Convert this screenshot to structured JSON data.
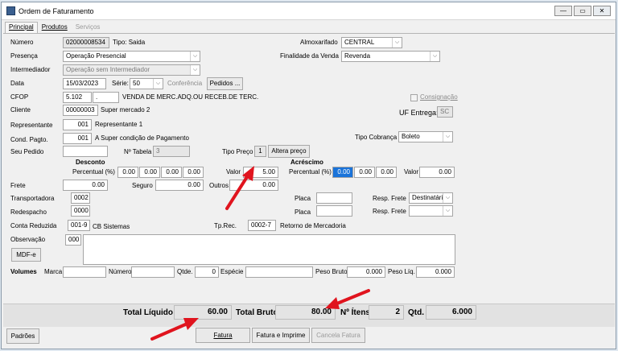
{
  "window": {
    "title": "Ordem de Faturamento",
    "min": "—",
    "max": "▭",
    "close": "✕"
  },
  "tabs": [
    {
      "label": "Principal"
    },
    {
      "label": "Produtos"
    },
    {
      "label": "Serviços"
    }
  ],
  "header": {
    "numero_label": "Número",
    "numero": "02000008534",
    "tipo": "Tipo: Saida",
    "almox_label": "Almoxarifado",
    "almox": "CENTRAL",
    "presenca_label": "Presença",
    "presenca": "Operação Presencial",
    "finalidade_label": "Finalidade da Venda",
    "finalidade": "Revenda",
    "intermediador_label": "Intermediador",
    "intermediador": "Operação sem Intermediador",
    "data_label": "Data",
    "data": "15/03/2023",
    "serie_label": "Série:",
    "serie": "50",
    "conferencia": "Conferência",
    "pedidos": "Pedidos ...",
    "cfop_label": "CFOP",
    "cfop": "5.102",
    "cfop_extra": ".",
    "cfop_desc": "VENDA DE MERC.ADQ.OU RECEB.DE TERC.",
    "consignacao": "Consignação",
    "cliente_label": "Cliente",
    "cliente_cod": "00000003",
    "cliente_nome": "Super mercado 2",
    "uf_label": "UF Entrega:",
    "uf": "SC",
    "rep_label": "Representante",
    "rep_cod": "001",
    "rep_nome": "Representante 1",
    "cond_label": "Cond. Pagto.",
    "cond_cod": "001",
    "cond_nome": "A Super condição de Pagamento",
    "tipocob_label": "Tipo Cobrança",
    "tipocob": "Boleto",
    "pedido_label": "Seu Pedido",
    "pedido": "",
    "ntabela_label": "Nº Tabela",
    "ntabela": "3",
    "tipopreco_label": "Tipo Preço",
    "tipopreco": "1",
    "altera_preco": "Altera preço"
  },
  "desconto": {
    "title": "Desconto",
    "percentual_label": "Percentual (%)",
    "percent": [
      "0.00",
      "0.00",
      "0.00",
      "0.00"
    ],
    "valor_label": "Valor",
    "valor": "5.00"
  },
  "acrescimo": {
    "title": "Acréscimo",
    "percentual_label": "Percentual (%)",
    "percent": [
      "0.00",
      "0.00",
      "0.00"
    ],
    "valor_label": "Valor",
    "valor": "0.00"
  },
  "frete": {
    "label": "Frete",
    "valor": "0.00",
    "seguro_label": "Seguro",
    "seguro": "0.00",
    "outros_label": "Outros",
    "outros": "0.00"
  },
  "transp": {
    "label": "Transportadora",
    "cod": "0002",
    "placa_label": "Placa",
    "placa": "",
    "resp_label": "Resp. Frete",
    "resp": "Destinatário"
  },
  "redesp": {
    "label": "Redespacho",
    "cod": "0000",
    "placa_label": "Placa",
    "placa": "",
    "resp_label": "Resp. Frete",
    "resp": ""
  },
  "conta": {
    "label": "Conta Reduzida",
    "cod": "001-9",
    "nome": "CB Sistemas",
    "tprec_label": "Tp.Rec.",
    "tprec": "0002-7",
    "tprec_desc": "Retorno de Mercadoria"
  },
  "obs": {
    "label": "Observação",
    "cod": "000",
    "text": ""
  },
  "mdfe": "MDF-e",
  "volumes": {
    "label": "Volumes",
    "marca_label": "Marca",
    "marca": "",
    "numero_label": "Número",
    "numero": "",
    "qtde_label": "Qtde.",
    "qtde": "0",
    "especie_label": "Espécie",
    "especie": "",
    "pbruto_label": "Peso Bruto",
    "pbruto": "0.000",
    "pliq_label": "Peso Líq.",
    "pliq": "0.000"
  },
  "totais": {
    "liquido_label": "Total Líquido",
    "liquido": "60.00",
    "bruto_label": "Total Bruto",
    "bruto": "80.00",
    "itens_label": "Nº Ítens",
    "itens": "2",
    "qtd_label": "Qtd.",
    "qtd": "6.000"
  },
  "footer": {
    "padroes": "Padrões",
    "fatura": "Fatura",
    "fatura_imprime": "Fatura e Imprime",
    "cancela": "Cancela Fatura"
  },
  "colors": {
    "selection": "#1a73d9",
    "arrow": "#e0141e"
  }
}
